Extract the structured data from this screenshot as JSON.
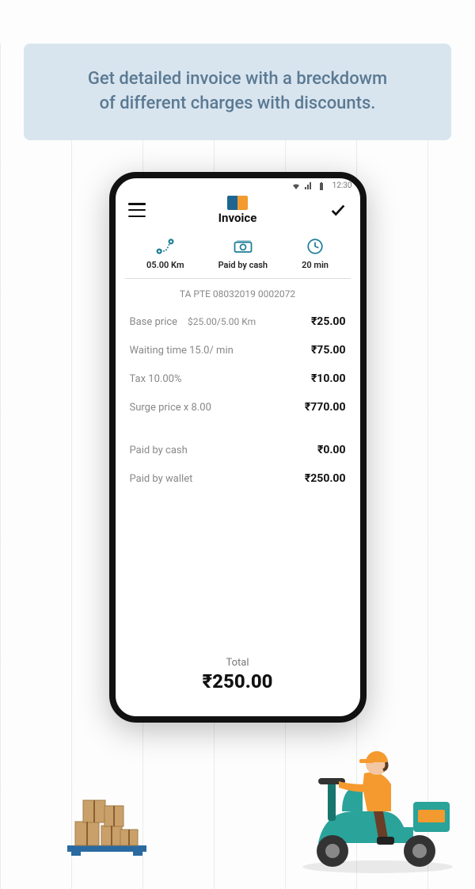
{
  "banner": {
    "line1": "Get detailed invoice with a breckdowm",
    "line2": "of different charges with discounts."
  },
  "status_bar": {
    "time": "12:30"
  },
  "header": {
    "title": "Invoice"
  },
  "summary": {
    "distance": {
      "label": "05.00 Km"
    },
    "payment": {
      "label": "Paid by cash"
    },
    "duration": {
      "label": "20 min"
    }
  },
  "invoice_id": "TA PTE 08032019 0002072",
  "lines": {
    "base": {
      "label": "Base price",
      "sub": "$25.00/5.00 Km",
      "amount": "₹25.00"
    },
    "waiting": {
      "label": "Waiting time 15.0/ min",
      "amount": "₹75.00"
    },
    "tax": {
      "label": "Tax 10.00%",
      "amount": "₹10.00"
    },
    "surge": {
      "label": "Surge price x 8.00",
      "amount": "₹770.00"
    },
    "cash": {
      "label": "Paid by cash",
      "amount": "₹0.00"
    },
    "wallet": {
      "label": "Paid by wallet",
      "amount": "₹250.00"
    }
  },
  "total": {
    "label": "Total",
    "amount": "₹250.00"
  }
}
